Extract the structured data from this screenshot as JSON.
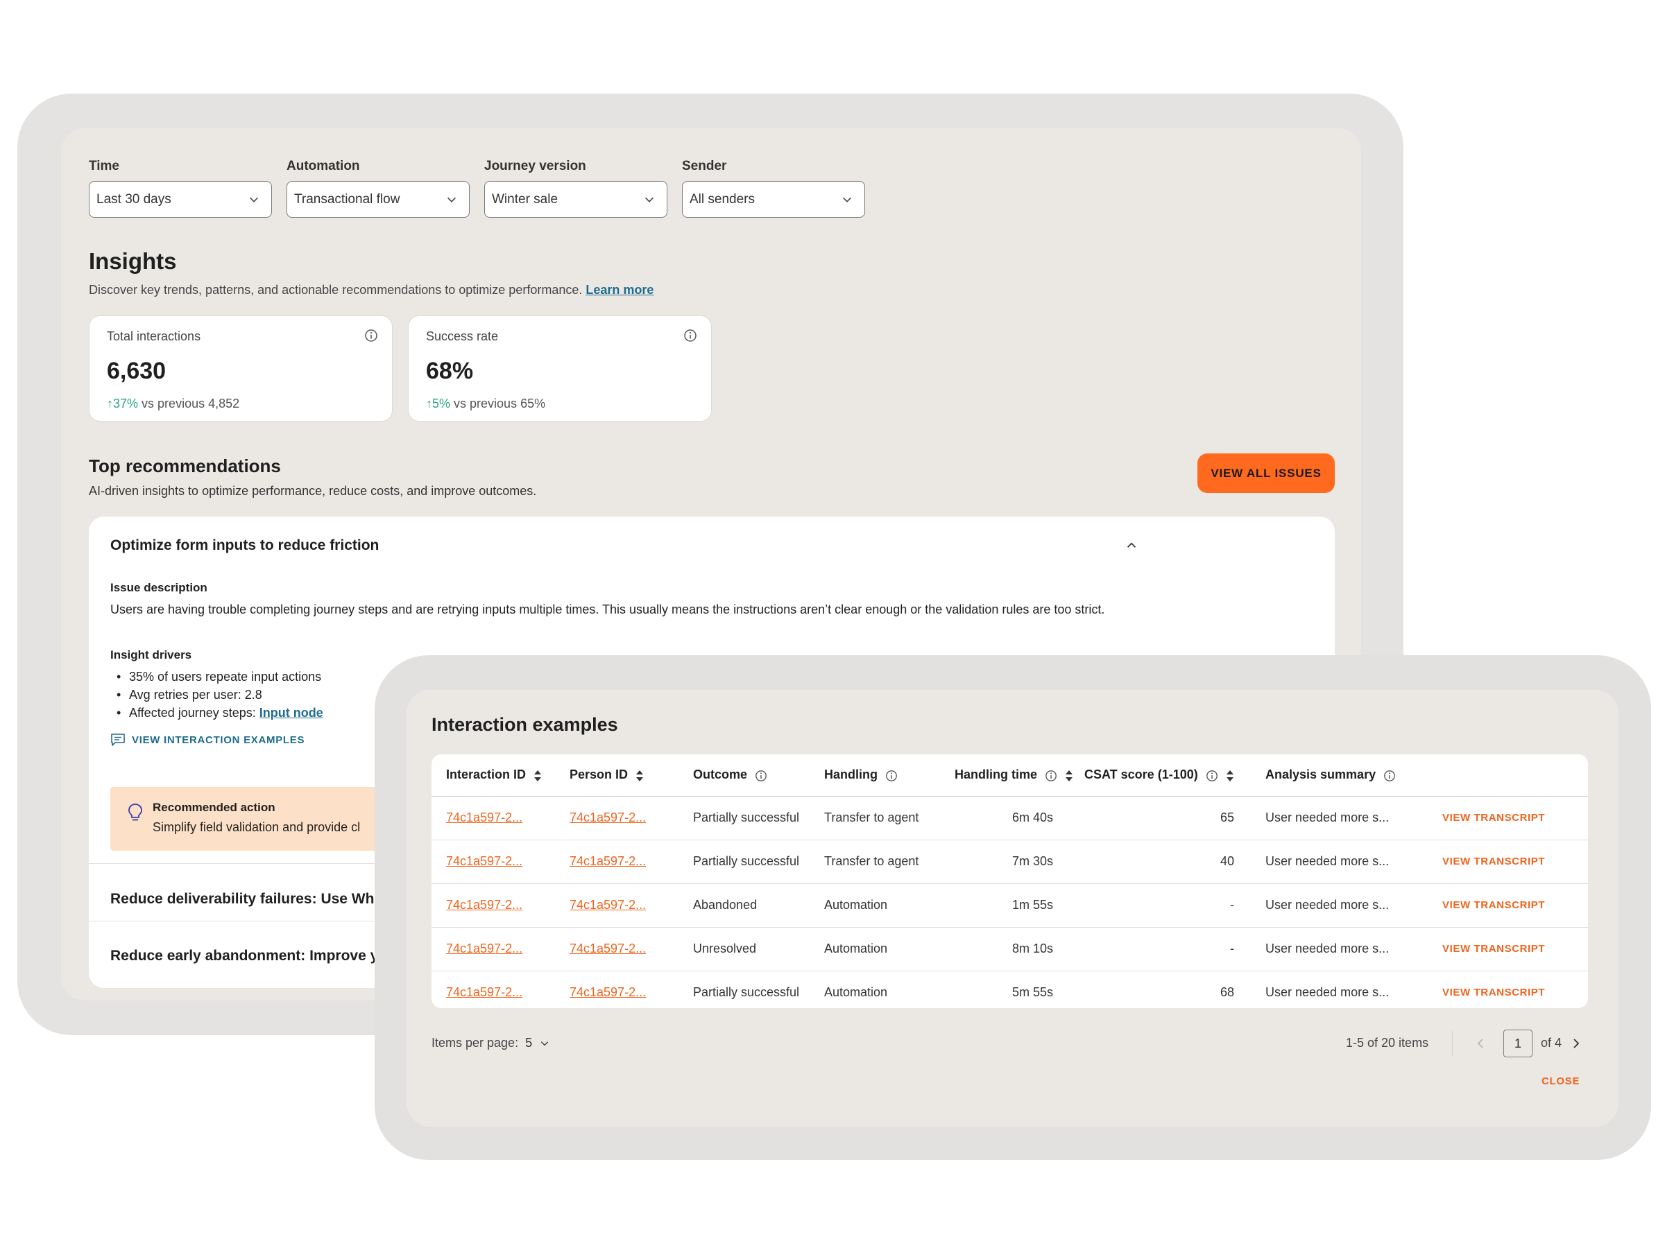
{
  "filters": [
    {
      "label": "Time",
      "value": "Last 30 days"
    },
    {
      "label": "Automation",
      "value": "Transactional flow"
    },
    {
      "label": "Journey version",
      "value": "Winter sale"
    },
    {
      "label": "Sender",
      "value": "All senders"
    }
  ],
  "insights": {
    "title": "Insights",
    "subtitle": "Discover key trends, patterns, and actionable recommendations to optimize performance.",
    "learn_more": "Learn more"
  },
  "kpis": [
    {
      "label": "Total interactions",
      "value": "6,630",
      "delta": "37%",
      "comparison": "vs previous 4,852"
    },
    {
      "label": "Success rate",
      "value": "68%",
      "delta": "5%",
      "comparison": "vs previous 65%"
    }
  ],
  "recommendations": {
    "title": "Top recommendations",
    "subtitle": "AI-driven insights to optimize performance, reduce costs, and improve outcomes.",
    "view_all_label": "VIEW ALL ISSUES",
    "expanded": {
      "title": "Optimize form inputs to reduce friction",
      "issue_label": "Issue description",
      "issue_text": "Users are having trouble completing journey steps and are retrying inputs multiple times. This usually means the instructions aren’t clear enough or the validation rules are too strict.",
      "drivers_label": "Insight drivers",
      "drivers": [
        "35% of users repeate input actions",
        "Avg retries per user: 2.8"
      ],
      "affected_prefix": "Affected journey steps:",
      "affected_link": "Input node",
      "view_examples_label": "VIEW INTERACTION EXAMPLES",
      "action_title": "Recommended action",
      "action_text": "Simplify field validation and provide cl"
    },
    "collapsed": [
      "Reduce deliverability failures: Use Wha",
      "Reduce early abandonment: Improve y"
    ]
  },
  "interaction_examples": {
    "title": "Interaction examples",
    "columns": [
      "Interaction ID",
      "Person ID",
      "Outcome",
      "Handling",
      "Handling time",
      "CSAT score (1-100)",
      "Analysis summary"
    ],
    "rows": [
      {
        "interaction_id": "74c1a597-2...",
        "person_id": "74c1a597-2...",
        "outcome": "Partially successful",
        "handling": "Transfer to agent",
        "time": "6m 40s",
        "csat": "65",
        "summary": "User needed more s...",
        "action": "VIEW TRANSCRIPT"
      },
      {
        "interaction_id": "74c1a597-2...",
        "person_id": "74c1a597-2...",
        "outcome": "Partially successful",
        "handling": "Transfer to agent",
        "time": "7m 30s",
        "csat": "40",
        "summary": "User needed more s...",
        "action": "VIEW TRANSCRIPT"
      },
      {
        "interaction_id": "74c1a597-2...",
        "person_id": "74c1a597-2...",
        "outcome": "Abandoned",
        "handling": "Automation",
        "time": "1m 55s",
        "csat": "-",
        "summary": "User needed more s...",
        "action": "VIEW TRANSCRIPT"
      },
      {
        "interaction_id": "74c1a597-2...",
        "person_id": "74c1a597-2...",
        "outcome": "Unresolved",
        "handling": "Automation",
        "time": "8m 10s",
        "csat": "-",
        "summary": "User needed more s...",
        "action": "VIEW TRANSCRIPT"
      },
      {
        "interaction_id": "74c1a597-2...",
        "person_id": "74c1a597-2...",
        "outcome": "Partially successful",
        "handling": "Automation",
        "time": "5m 55s",
        "csat": "68",
        "summary": "User needed more s...",
        "action": "VIEW TRANSCRIPT"
      }
    ],
    "pagination": {
      "items_per_page_label": "Items per page:",
      "items_per_page": "5",
      "count_text": "1-5 of 20 items",
      "current_page": "1",
      "of_pages": "of 4"
    },
    "close_label": "CLOSE"
  },
  "colors": {
    "accent": "#ff6a1f",
    "link": "#1f6c8f",
    "positive": "#2aa37a",
    "recommended_bg": "#fde0c8"
  },
  "icons": [
    "chevron-down-icon",
    "info-icon",
    "arrow-up-icon",
    "chevron-up-icon",
    "chat-icon",
    "lightbulb-icon",
    "sort-icon",
    "chevron-left-icon",
    "chevron-right-icon"
  ]
}
